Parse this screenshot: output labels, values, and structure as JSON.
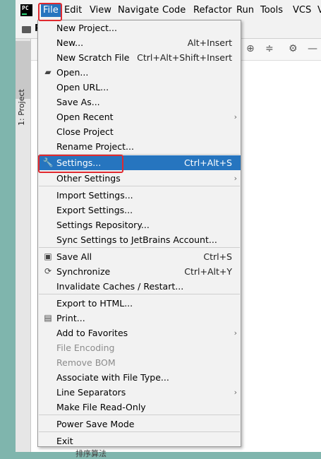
{
  "menubar": {
    "logo_text": "PC",
    "items": [
      "File",
      "Edit",
      "View",
      "Navigate",
      "Code",
      "Refactor",
      "Run",
      "Tools",
      "VCS",
      "V"
    ]
  },
  "navbar": {
    "project_initial": "P"
  },
  "tool_window": {
    "project_tab": "1: Project"
  },
  "file_menu": {
    "items": [
      {
        "label": "New Project...",
        "shortcut": "",
        "submenu": false,
        "icon": "",
        "enabled": true
      },
      {
        "label": "New...",
        "shortcut": "Alt+Insert",
        "submenu": false,
        "icon": "",
        "enabled": true
      },
      {
        "label": "New Scratch File",
        "shortcut": "Ctrl+Alt+Shift+Insert",
        "submenu": false,
        "icon": "",
        "enabled": true
      },
      {
        "label": "Open...",
        "shortcut": "",
        "submenu": false,
        "icon": "folder-open-icon",
        "enabled": true
      },
      {
        "label": "Open URL...",
        "shortcut": "",
        "submenu": false,
        "icon": "",
        "enabled": true
      },
      {
        "label": "Save As...",
        "shortcut": "",
        "submenu": false,
        "icon": "",
        "enabled": true
      },
      {
        "label": "Open Recent",
        "shortcut": "",
        "submenu": true,
        "icon": "",
        "enabled": true
      },
      {
        "label": "Close Project",
        "shortcut": "",
        "submenu": false,
        "icon": "",
        "enabled": true
      },
      {
        "label": "Rename Project...",
        "shortcut": "",
        "submenu": false,
        "icon": "",
        "enabled": true
      },
      {
        "label": "Settings...",
        "shortcut": "Ctrl+Alt+S",
        "submenu": false,
        "icon": "wrench-icon",
        "enabled": true,
        "highlighted": true
      },
      {
        "label": "Other Settings",
        "shortcut": "",
        "submenu": true,
        "icon": "",
        "enabled": true
      },
      {
        "label": "Import Settings...",
        "shortcut": "",
        "submenu": false,
        "icon": "",
        "enabled": true
      },
      {
        "label": "Export Settings...",
        "shortcut": "",
        "submenu": false,
        "icon": "",
        "enabled": true
      },
      {
        "label": "Settings Repository...",
        "shortcut": "",
        "submenu": false,
        "icon": "",
        "enabled": true
      },
      {
        "label": "Sync Settings to JetBrains Account...",
        "shortcut": "",
        "submenu": false,
        "icon": "",
        "enabled": true
      },
      {
        "label": "Save All",
        "shortcut": "Ctrl+S",
        "submenu": false,
        "icon": "save-icon",
        "enabled": true
      },
      {
        "label": "Synchronize",
        "shortcut": "Ctrl+Alt+Y",
        "submenu": false,
        "icon": "sync-icon",
        "enabled": true
      },
      {
        "label": "Invalidate Caches / Restart...",
        "shortcut": "",
        "submenu": false,
        "icon": "",
        "enabled": true
      },
      {
        "label": "Export to HTML...",
        "shortcut": "",
        "submenu": false,
        "icon": "",
        "enabled": true
      },
      {
        "label": "Print...",
        "shortcut": "",
        "submenu": false,
        "icon": "print-icon",
        "enabled": true
      },
      {
        "label": "Add to Favorites",
        "shortcut": "",
        "submenu": true,
        "icon": "",
        "enabled": true
      },
      {
        "label": "File Encoding",
        "shortcut": "",
        "submenu": false,
        "icon": "",
        "enabled": false
      },
      {
        "label": "Remove BOM",
        "shortcut": "",
        "submenu": false,
        "icon": "",
        "enabled": false
      },
      {
        "label": "Associate with File Type...",
        "shortcut": "",
        "submenu": false,
        "icon": "",
        "enabled": true
      },
      {
        "label": "Line Separators",
        "shortcut": "",
        "submenu": true,
        "icon": "",
        "enabled": true
      },
      {
        "label": "Make File Read-Only",
        "shortcut": "",
        "submenu": false,
        "icon": "",
        "enabled": true
      },
      {
        "label": "Power Save Mode",
        "shortcut": "",
        "submenu": false,
        "icon": "",
        "enabled": true
      },
      {
        "label": "Exit",
        "shortcut": "",
        "submenu": false,
        "icon": "",
        "enabled": true
      }
    ]
  },
  "bottom_tree_text": "排序算法",
  "colors": {
    "highlight": "#2675bf",
    "annotation_red": "#e0292f",
    "desktop": "#7fb5ad"
  }
}
